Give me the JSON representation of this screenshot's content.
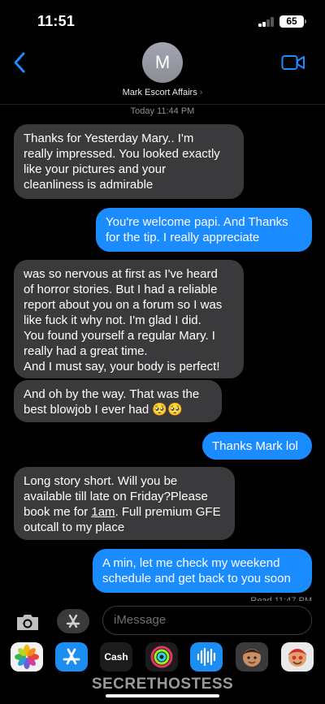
{
  "status_bar": {
    "time": "11:51",
    "battery": "65",
    "signal_icon": "cellular-signal-icon"
  },
  "header": {
    "avatar_initial": "M",
    "contact_name": "Mark Escort Affairs",
    "contact_chevron": "›",
    "back_icon": "chevron-left-icon",
    "video_icon": "video-camera-icon",
    "accent_color": "#1a8cff"
  },
  "timestamp": "Today 11:44 PM",
  "messages": [
    {
      "direction": "incoming",
      "lines": [
        "Thanks for Yesterday Mary.. I'm",
        "really impressed. You looked exactly",
        "like your pictures and your",
        "cleanliness is admirable"
      ]
    },
    {
      "direction": "outgoing",
      "lines": [
        "You're welcome papi. And Thanks",
        "for the tip. I really appreciate"
      ]
    },
    {
      "direction": "incoming",
      "lines": [
        "was so nervous at first as I've heard",
        "of horror stories. But I had a reliable",
        "report about you on a forum so I was",
        "like fuck it why not. I'm glad I did.",
        "You found yourself a regular Mary. I",
        "really had a great time.",
        "And I must say, your body is perfect!"
      ]
    },
    {
      "direction": "incoming",
      "lines": [
        "And oh by the way. That was the",
        "best blowjob I ever had 🥺🥺"
      ]
    },
    {
      "direction": "outgoing",
      "lines": [
        "Thanks Mark lol"
      ]
    },
    {
      "direction": "incoming",
      "lines": [
        "Long story short. Will you be",
        "available till late on Friday?Please",
        "book me for ",
        "1am",
        ". Full premium GFE",
        "outcall to my place"
      ]
    },
    {
      "direction": "outgoing",
      "lines": [
        "A min, let me check my weekend",
        "schedule and get back to you soon"
      ]
    }
  ],
  "read_receipt": "Read 11:47 PM",
  "input": {
    "placeholder": "iMessage",
    "camera_icon": "camera-icon",
    "apps_icon": "app-store-icon"
  },
  "app_drawer": {
    "apps": [
      "photos-icon",
      "app-store-icon",
      "apple-cash-icon",
      "activity-icon",
      "audio-message-icon",
      "memoji-icon",
      "memoji-stickers-icon"
    ],
    "cash_label": "Cash"
  },
  "watermark": "SECRETHOSTESS",
  "colors": {
    "incoming_bubble": "#3a3a3c",
    "outgoing_bubble": "#1a8cff",
    "background": "#000000"
  }
}
